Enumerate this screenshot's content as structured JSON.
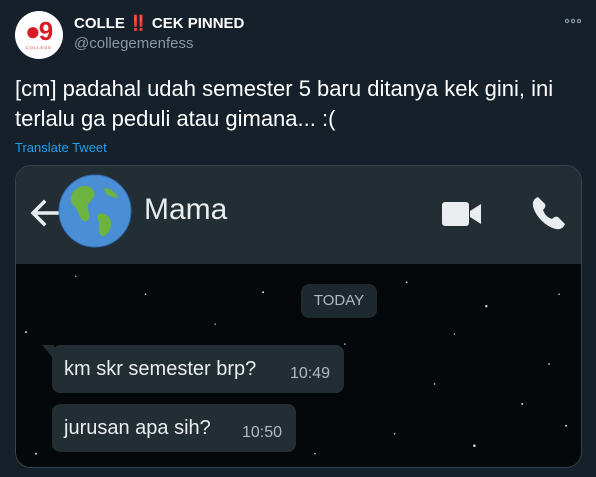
{
  "account": {
    "name_prefix": "COLLE",
    "name_emoji": "‼️",
    "name_suffix": "CEK PINNED",
    "handle": "@collegemenfess",
    "avatar_logo": "9",
    "avatar_text": "COLLEGE"
  },
  "tweet": {
    "text": "[cm] padahal udah semester 5 baru ditanya kek gini, ini terlalu ga peduli atau gimana... :(",
    "translate_label": "Translate Tweet"
  },
  "media": {
    "contact_name": "Mama",
    "date_label": "TODAY",
    "messages": [
      {
        "text": "km skr semester brp?",
        "time": "10:49"
      },
      {
        "text": "jurusan apa sih?",
        "time": "10:50"
      }
    ],
    "icons": {
      "back": "arrow-left-icon",
      "avatar": "globe-icon",
      "video": "video-camera-icon",
      "call": "phone-icon"
    }
  },
  "colors": {
    "background": "#15202b",
    "link": "#1da1f2",
    "muted": "#8899a6",
    "wa_header": "#222d34",
    "bubble": "#222d34"
  }
}
